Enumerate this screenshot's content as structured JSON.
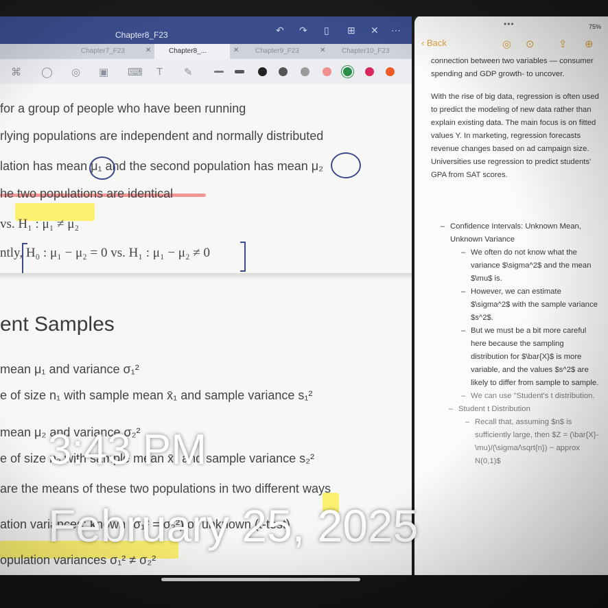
{
  "left_app": {
    "doc_title": "Chapter8_F23",
    "tabs": [
      "Chapter7_F23",
      "Chapter8_...",
      "Chapter9_F23",
      "Chapter10_F23"
    ],
    "lines": {
      "l1": "for a group of people who have been running",
      "l2": "rlying populations are independent and normally distributed",
      "l3": "lation has mean μ₁ and the second population has mean μ₂",
      "l4": "he two populations are identical",
      "l5": "vs. H₁ : μ₁ ≠ μ₂",
      "l6": "ntly, H₀ : μ₁ − μ₂ = 0 vs. H₁ : μ₁ − μ₂ ≠ 0",
      "heading": "ent Samples",
      "l7": "mean μ₁ and variance σ₁²",
      "l8": "e of size n₁ with sample mean x̄₁ and sample variance s₁²",
      "l9": "mean μ₂ and variance σ₂²",
      "l10": "e of size n₂ with sample mean x̄₂ and sample variance s₂²",
      "l11": "are the means of these two populations in two different ways",
      "l12": "ation variances: known (σ₁² = σ₂²) or unknown (t-test)",
      "l13": "opulation variances σ₁² ≠ σ₂²"
    }
  },
  "right_app": {
    "status": "75%",
    "back_label": "Back",
    "para1": "connection between two variables — consumer spending and GDP growth- to uncover.",
    "para2": "With the rise of big data, regression is often used to predict the modeling of new data rather than explain existing data. The main focus is on fitted values Y. In marketing, regression forecasts revenue changes based on ad campaign size. Universities use regression to predict students' GPA from SAT scores.",
    "b1": "Confidence Intervals: Unknown Mean, Unknown Variance",
    "b1a": "We often do not know what the variance $\\sigma^2$ and the mean $\\mu$ is.",
    "b1b": "However, we can estimate $\\sigma^2$ with the sample variance $s^2$.",
    "b1c": "But we must be a bit more careful here because the sampling distribution for $\\bar{X}$ is more variable, and the values $s^2$ are likely to differ from sample to sample.",
    "b1d": "We can use \"Student's t distribution.",
    "b2": "Student t Distribution",
    "b2a": "Recall that, assuming $n$ is sufficiently large, then $Z = (\\bar{X}-\\mu)/(\\sigma/\\sqrt{n}) ~ approx N(0,1)$"
  },
  "overlay": {
    "time": "3:43 PM",
    "date": "February 25, 2025"
  },
  "colors": {
    "titlebar": "#3a4c8c",
    "accent_notes": "#e0a43a",
    "highlight_yellow": "#ffec28",
    "ink_blue": "#3b4a8a"
  }
}
